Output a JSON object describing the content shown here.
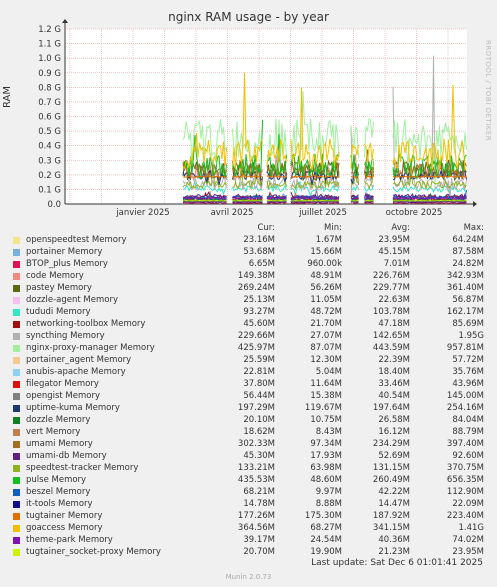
{
  "chart_data": {
    "type": "line",
    "title": "nginx RAM usage - by year",
    "ylabel": "RAM",
    "ylim": [
      0,
      1.2
    ],
    "y_unit": "G",
    "y_ticks": [
      "0.0",
      "0.1 G",
      "0.2 G",
      "0.3 G",
      "0.4 G",
      "0.5 G",
      "0.6 G",
      "0.7 G",
      "0.8 G",
      "0.9 G",
      "1.0 G",
      "1.1 G",
      "1.2 G"
    ],
    "x_ticks": [
      "janvier 2025",
      "avril 2025",
      "juillet 2025",
      "octobre 2025"
    ],
    "grid": true,
    "columns": {
      "cur": "Cur:",
      "min": "Min:",
      "avg": "Avg:",
      "max": "Max:"
    },
    "series": [
      {
        "name": "openspeedtest Memory",
        "color": "#f5e58a",
        "cur": "23.16M",
        "min": "1.67M",
        "avg": "23.95M",
        "max": "64.24M"
      },
      {
        "name": "portainer Memory",
        "color": "#7ab0e0",
        "cur": "53.68M",
        "min": "15.66M",
        "avg": "45.15M",
        "max": "87.58M"
      },
      {
        "name": "BTOP_plus Memory",
        "color": "#e0105a",
        "cur": "6.65M",
        "min": "960.00k",
        "avg": "7.01M",
        "max": "24.82M"
      },
      {
        "name": "code Memory",
        "color": "#ef8a80",
        "cur": "149.38M",
        "min": "48.91M",
        "avg": "226.76M",
        "max": "342.93M"
      },
      {
        "name": "pastey Memory",
        "color": "#5a6a10",
        "cur": "269.24M",
        "min": "56.26M",
        "avg": "229.77M",
        "max": "361.40M"
      },
      {
        "name": "dozzle-agent Memory",
        "color": "#f5c0f0",
        "cur": "25.13M",
        "min": "11.05M",
        "avg": "22.63M",
        "max": "56.87M"
      },
      {
        "name": "tududi Memory",
        "color": "#30e8c8",
        "cur": "93.27M",
        "min": "48.72M",
        "avg": "103.78M",
        "max": "162.17M"
      },
      {
        "name": "networking-toolbox Memory",
        "color": "#a01010",
        "cur": "45.60M",
        "min": "21.70M",
        "avg": "47.18M",
        "max": "85.69M"
      },
      {
        "name": "syncthing Memory",
        "color": "#b0b0b0",
        "cur": "229.66M",
        "min": "27.07M",
        "avg": "142.65M",
        "max": "1.95G"
      },
      {
        "name": "nginx-proxy-manager Memory",
        "color": "#a0f0a0",
        "cur": "425.97M",
        "min": "87.07M",
        "avg": "443.59M",
        "max": "957.81M"
      },
      {
        "name": "portainer_agent Memory",
        "color": "#f5c890",
        "cur": "25.59M",
        "min": "12.30M",
        "avg": "22.39M",
        "max": "57.72M"
      },
      {
        "name": "anubis-apache Memory",
        "color": "#90d0f0",
        "cur": "22.81M",
        "min": "5.04M",
        "avg": "18.40M",
        "max": "35.76M"
      },
      {
        "name": "filegator Memory",
        "color": "#e01010",
        "cur": "37.80M",
        "min": "11.64M",
        "avg": "33.46M",
        "max": "43.96M"
      },
      {
        "name": "opengist Memory",
        "color": "#808080",
        "cur": "56.44M",
        "min": "15.38M",
        "avg": "40.54M",
        "max": "145.00M"
      },
      {
        "name": "uptime-kuma Memory",
        "color": "#1a3a70",
        "cur": "197.29M",
        "min": "119.67M",
        "avg": "197.64M",
        "max": "254.16M"
      },
      {
        "name": "dozzle Memory",
        "color": "#108020",
        "cur": "20.10M",
        "min": "10.75M",
        "avg": "26.58M",
        "max": "84.04M"
      },
      {
        "name": "vert Memory",
        "color": "#c08050",
        "cur": "18.62M",
        "min": "8.43M",
        "avg": "16.12M",
        "max": "88.79M"
      },
      {
        "name": "umami Memory",
        "color": "#a07020",
        "cur": "302.33M",
        "min": "97.34M",
        "avg": "234.29M",
        "max": "397.40M"
      },
      {
        "name": "umami-db Memory",
        "color": "#602080",
        "cur": "45.30M",
        "min": "17.93M",
        "avg": "52.69M",
        "max": "92.60M"
      },
      {
        "name": "speedtest-tracker Memory",
        "color": "#90b020",
        "cur": "133.21M",
        "min": "63.98M",
        "avg": "131.15M",
        "max": "370.75M"
      },
      {
        "name": "pulse Memory",
        "color": "#10c020",
        "cur": "435.53M",
        "min": "48.60M",
        "avg": "260.49M",
        "max": "656.35M"
      },
      {
        "name": "beszel Memory",
        "color": "#1060c0",
        "cur": "68.21M",
        "min": "9.97M",
        "avg": "42.22M",
        "max": "112.90M"
      },
      {
        "name": "it-tools Memory",
        "color": "#101090",
        "cur": "14.78M",
        "min": "8.88M",
        "avg": "14.47M",
        "max": "22.09M"
      },
      {
        "name": "tugtainer Memory",
        "color": "#e07000",
        "cur": "177.26M",
        "min": "175.30M",
        "avg": "187.92M",
        "max": "223.40M"
      },
      {
        "name": "goaccess Memory",
        "color": "#f0c000",
        "cur": "364.56M",
        "min": "68.27M",
        "avg": "341.15M",
        "max": "1.41G"
      },
      {
        "name": "theme-park Memory",
        "color": "#8010b0",
        "cur": "39.17M",
        "min": "24.54M",
        "avg": "40.36M",
        "max": "74.02M"
      },
      {
        "name": "tugtainer_socket-proxy Memory",
        "color": "#d0f000",
        "cur": "20.70M",
        "min": "19.90M",
        "avg": "21.23M",
        "max": "23.95M"
      }
    ]
  },
  "footer": {
    "last_update": "Last update: Sat Dec  6 01:01:41 2025",
    "generator": "Munin 2.0.73",
    "watermark": "RRDTOOL / TOBI OETIKER"
  }
}
